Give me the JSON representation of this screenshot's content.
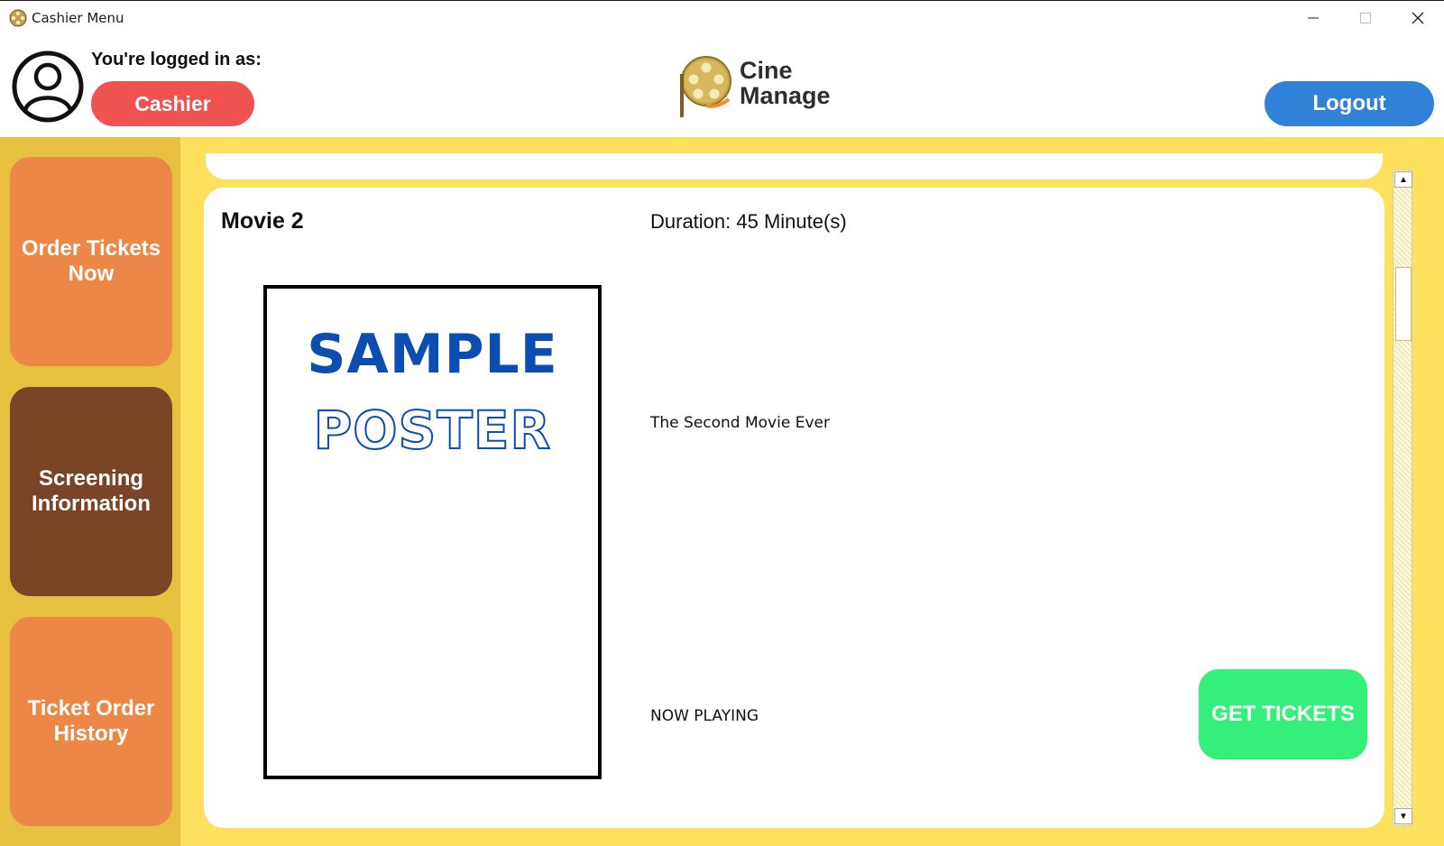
{
  "window": {
    "title": "Cashier Menu"
  },
  "header": {
    "logged_in_label": "You're logged in as:",
    "role": "Cashier",
    "logo_line1": "Cine",
    "logo_line2": "Manage",
    "logout_label": "Logout"
  },
  "sidebar": {
    "items": [
      {
        "label": "Order Tickets Now"
      },
      {
        "label": "Screening Information"
      },
      {
        "label": "Ticket Order History"
      }
    ]
  },
  "movie": {
    "title": "Movie 2",
    "duration": "Duration: 45 Minute(s)",
    "poster_line1": "SAMPLE",
    "poster_line2": "POSTER",
    "description": "The Second Movie Ever",
    "status": "NOW PLAYING",
    "get_tickets_label": "GET TICKETS"
  },
  "colors": {
    "role_badge": "#ef5350",
    "logout": "#2f82d8",
    "sidebar_bg": "#e8c040",
    "nav_orange": "#ec8748",
    "nav_brown": "#7b4426",
    "content_bg": "#fde05d",
    "get_tickets": "#34f07b"
  },
  "icons": {
    "app": "film-reel-icon",
    "avatar": "user-icon",
    "minimize": "minimize-icon",
    "maximize": "maximize-icon",
    "close": "close-icon"
  }
}
